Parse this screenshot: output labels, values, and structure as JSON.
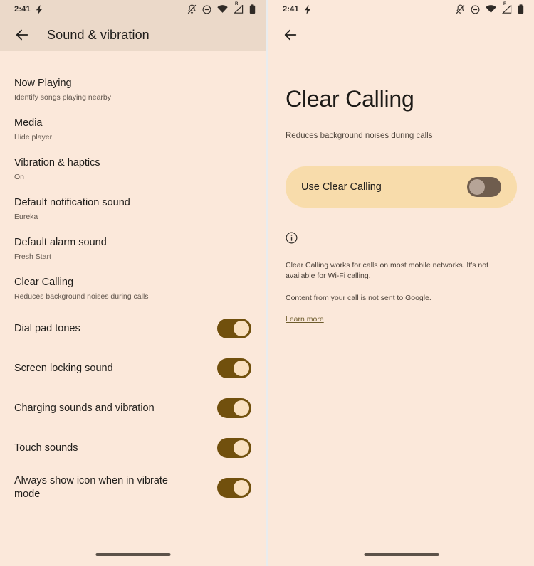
{
  "status_bar": {
    "time": "2:41",
    "icons": [
      "bolt-icon",
      "bell-muted-icon",
      "dnd-icon",
      "wifi-icon",
      "signal-roaming-icon",
      "battery-icon"
    ],
    "roaming_badge": "R"
  },
  "colors": {
    "screen_bg": "#FBE8DA",
    "header_bg": "#EBD9C9",
    "switch_on_track": "#71500D",
    "switch_on_knob": "#F9E0C0",
    "switch_off_track": "#6F5D4E",
    "switch_off_knob": "#B6A497",
    "card_bg": "#F8DCAB",
    "link": "#6D5B2C",
    "text_primary": "#201E1B",
    "text_secondary": "#63584F"
  },
  "left_screen": {
    "back_label": "Back",
    "title": "Sound & vibration",
    "clipped_text": "On",
    "items": [
      {
        "title": "Now Playing",
        "subtitle": "Identify songs playing nearby",
        "control": "none"
      },
      {
        "title": "Media",
        "subtitle": "Hide player",
        "control": "none"
      },
      {
        "title": "Vibration & haptics",
        "subtitle": "On",
        "control": "none"
      },
      {
        "title": "Default notification sound",
        "subtitle": "Eureka",
        "control": "none"
      },
      {
        "title": "Default alarm sound",
        "subtitle": "Fresh Start",
        "control": "none"
      },
      {
        "title": "Clear Calling",
        "subtitle": "Reduces background noises during calls",
        "control": "none"
      },
      {
        "title": "Dial pad tones",
        "subtitle": "",
        "control": "switch",
        "state": "on"
      },
      {
        "title": "Screen locking sound",
        "subtitle": "",
        "control": "switch",
        "state": "on"
      },
      {
        "title": "Charging sounds and vibration",
        "subtitle": "",
        "control": "switch",
        "state": "on"
      },
      {
        "title": "Touch sounds",
        "subtitle": "",
        "control": "switch",
        "state": "on"
      },
      {
        "title": "Always show icon when in vibrate mode",
        "subtitle": "",
        "control": "switch",
        "state": "on"
      }
    ]
  },
  "right_screen": {
    "back_label": "Back",
    "title": "Clear Calling",
    "subtitle": "Reduces background noises during calls",
    "preference": {
      "label": "Use Clear Calling",
      "state": "off"
    },
    "info_icon": "info-circle-icon",
    "notes": [
      "Clear Calling works for calls on most mobile networks. It's not available for Wi-Fi calling.",
      "Content from your call is not sent to Google."
    ],
    "link_label": "Learn more"
  }
}
